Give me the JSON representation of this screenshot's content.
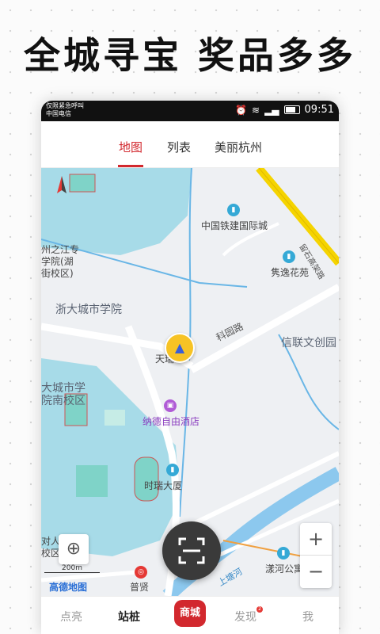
{
  "promo": {
    "title": "全城寻宝 奖品多多"
  },
  "statusbar": {
    "carrier_line1": "仅限紧急呼叫",
    "carrier_line2": "中国电信",
    "time": "09:51"
  },
  "tabs": [
    {
      "label": "地图",
      "active": true
    },
    {
      "label": "列表",
      "active": false
    },
    {
      "label": "美丽杭州",
      "active": false
    }
  ],
  "map": {
    "labels": {
      "china_railway": "中国铁建国际城",
      "juanyi": "隽逸花苑",
      "zhijiang": "州之江专\n学院(湖\n街校区)",
      "zju_city": "浙大城市学院",
      "keyuan_road": "科园路",
      "xinlian": "信联文创园",
      "tianrui": "天瑞",
      "zju_south": "大城市学\n院南校区",
      "nade_hotel": "纳德自由酒店",
      "shirui": "时瑞大厦",
      "yanghe": "漾河公寓",
      "puxian": "普贤",
      "shangtang_river": "上塘河",
      "bottom_left": "对人\n校区",
      "highway": "留石高架路",
      "scale": "200m",
      "attribution": "高德地图"
    }
  },
  "bottom_nav": [
    {
      "label": "点亮",
      "active": false
    },
    {
      "label": "站桩",
      "active": true
    },
    {
      "label": "商城",
      "active": false
    },
    {
      "label": "发现",
      "active": false,
      "badge": "2"
    },
    {
      "label": "我",
      "active": false
    }
  ],
  "colors": {
    "accent": "#d2282e",
    "water": "#a7dbe8",
    "campus": "#7fd3c8",
    "road_major": "#f5d400"
  }
}
